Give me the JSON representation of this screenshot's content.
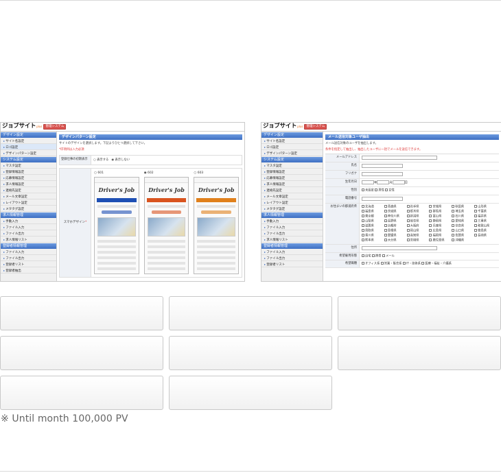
{
  "left_screenshot": {
    "logo": "ジョブサイト",
    "logo_plus": "plus",
    "badge": "管理システム",
    "sidebar": [
      {
        "heading": "デザイン設定",
        "items": [
          "サイト名設定",
          "ロゴ設定",
          "デザインパターン設定"
        ]
      },
      {
        "heading": "システム設定",
        "items": [
          "マスタ設定",
          "登録情報設定",
          "応募情報設定",
          "求人情報設定",
          "連絡先設定",
          "メール文章設定",
          "レイアウト設定",
          "メタタグ設定"
        ]
      },
      {
        "heading": "求人情報管理",
        "items": [
          "手動入力",
          "ファイル入力",
          "ファイル出力",
          "求人情報リスト"
        ]
      },
      {
        "heading": "登録者情報管理",
        "items": [
          "ファイル入力",
          "ファイル出力",
          "登録者リスト",
          "登録者抽出"
        ]
      }
    ],
    "title": "デザインパターン設定",
    "description": "サイトのデザインを選択します。下記よりひとつ選択して下さい。",
    "required_note": "*印項目は入力必須",
    "row_label": "登録仕事の初期表示",
    "radio_options": [
      "表示する",
      "表示しない"
    ],
    "designs_label": "スマホデザイン",
    "designs": [
      {
        "name": "601",
        "logo": "Driver's Job",
        "accent": "#1e4fb4"
      },
      {
        "name": "602",
        "logo": "Driver's Job",
        "accent": "#d9541f"
      },
      {
        "name": "603",
        "logo": "Driver's Job",
        "accent": "#e0801c"
      }
    ]
  },
  "right_screenshot": {
    "logo": "ジョブサイト",
    "logo_plus": "plus",
    "badge": "管理システム",
    "sidebar": [
      {
        "heading": "デザイン設定",
        "items": [
          "サイト名設定",
          "ロゴ設定",
          "デザインパターン設定"
        ]
      },
      {
        "heading": "システム設定",
        "items": [
          "マスタ設定",
          "登録情報設定",
          "応募情報設定",
          "求人情報設定",
          "連絡先設定",
          "メール文章設定",
          "レイアウト設定",
          "メタタグ設定"
        ]
      },
      {
        "heading": "求人情報管理",
        "items": [
          "手動入力",
          "ファイル入力",
          "ファイル出力",
          "求人情報リスト"
        ]
      },
      {
        "heading": "登録者情報管理",
        "items": [
          "ファイル入力",
          "ファイル出力",
          "登録者リスト"
        ]
      }
    ],
    "title": "メール送信対象ユーザ抽出",
    "description": "メール送信対象のユーザを抽出します。",
    "warning": "条件を指定して抽出し、抽出したユーザに一括でメールを送信できます。",
    "fields": [
      "メールアドレス",
      "氏名",
      "フリガナ",
      "生年月日",
      "性別",
      "電話番号",
      "お住まいの都道府県",
      "住所",
      "希望雇用形態",
      "希望職種"
    ],
    "gender_options": [
      "未設定",
      "男性",
      "女性"
    ],
    "date_units": [
      "年",
      "月",
      "日"
    ],
    "prefectures": [
      "北海道",
      "青森県",
      "岩手県",
      "宮城県",
      "秋田県",
      "山形県",
      "福島県",
      "茨城県",
      "栃木県",
      "群馬県",
      "埼玉県",
      "千葉県",
      "東京都",
      "神奈川県",
      "新潟県",
      "富山県",
      "石川県",
      "福井県",
      "山梨県",
      "長野県",
      "岐阜県",
      "静岡県",
      "愛知県",
      "三重県",
      "滋賀県",
      "京都府",
      "大阪府",
      "兵庫県",
      "奈良県",
      "和歌山県",
      "鳥取県",
      "島根県",
      "岡山県",
      "広島県",
      "山口県",
      "徳島県",
      "香川県",
      "愛媛県",
      "高知県",
      "福岡県",
      "佐賀県",
      "長崎県",
      "熊本県",
      "大分県",
      "宮崎県",
      "鹿児島県",
      "沖縄県"
    ],
    "employment_options": [
      "自宅",
      "携帯",
      "メール"
    ],
    "job_options": [
      "オフィス系",
      "営業・販売系",
      "IT・技術系",
      "医療・福祉・介護系"
    ]
  },
  "footnote": "※ Until month 100,000 PV"
}
